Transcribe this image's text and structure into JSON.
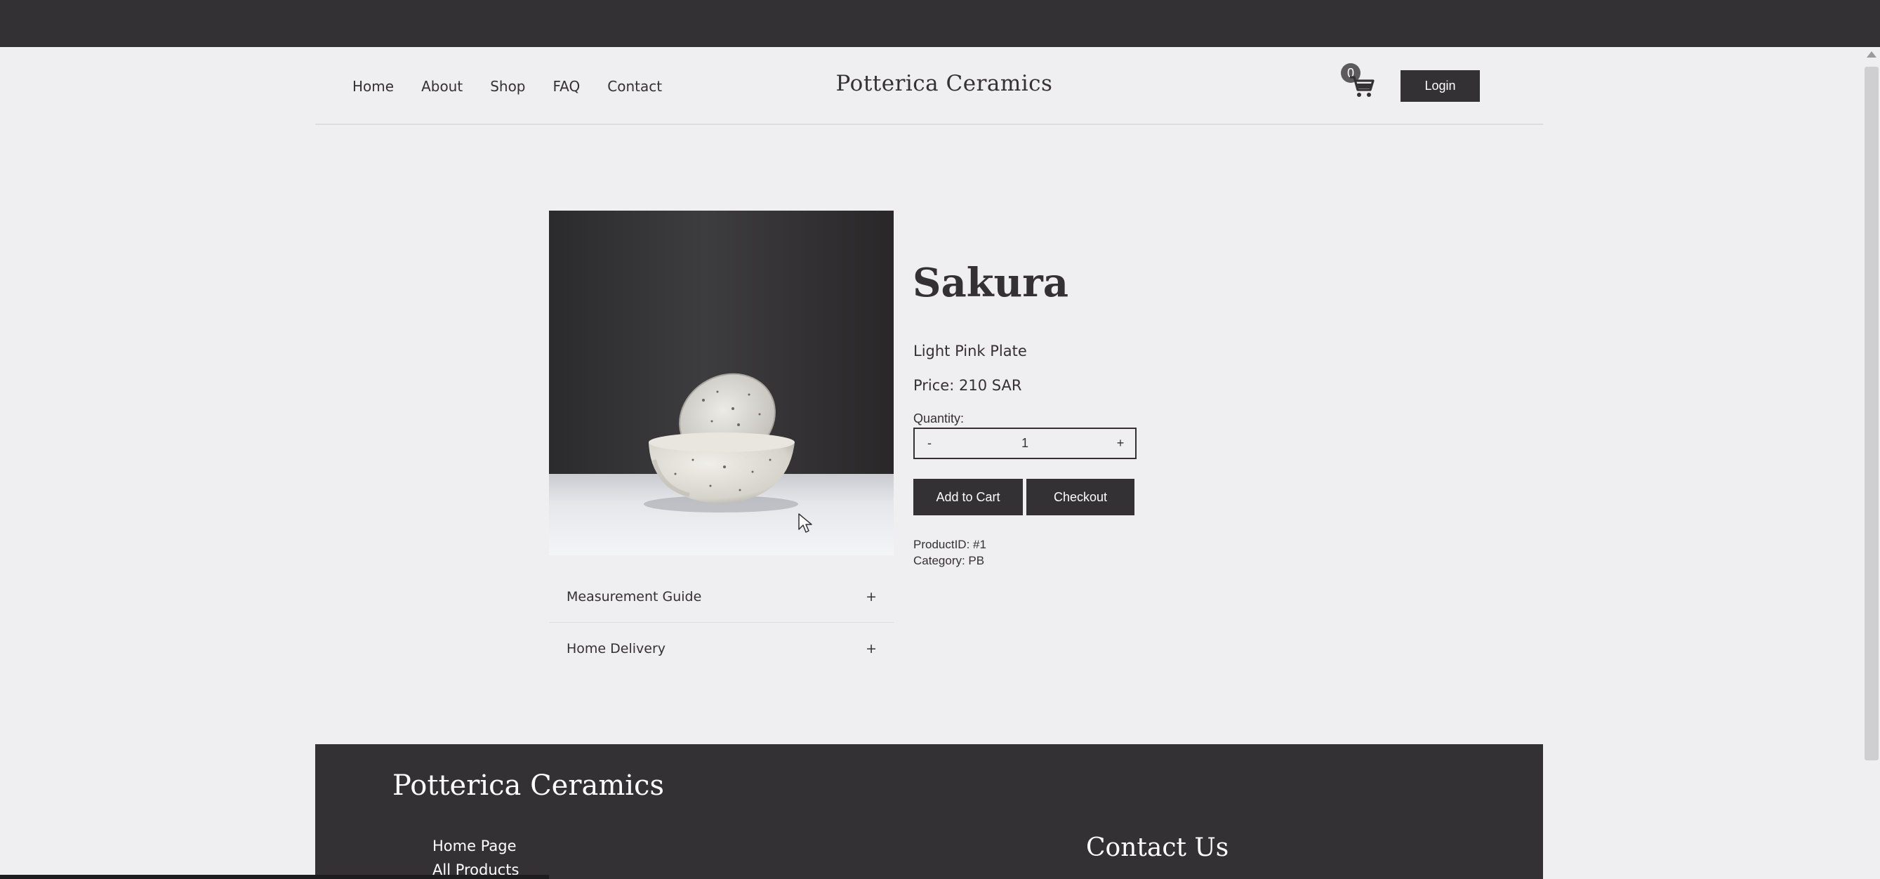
{
  "header": {
    "nav": [
      "Home",
      "About",
      "Shop",
      "FAQ",
      "Contact"
    ],
    "brand": "Potterica Ceramics",
    "cart_count": "0",
    "login_label": "Login"
  },
  "product": {
    "title": "Sakura",
    "subtitle": "Light Pink Plate",
    "price": "Price: 210 SAR",
    "quantity_label": "Quantity:",
    "quantity_minus": "-",
    "quantity_value": "1",
    "quantity_plus": "+",
    "add_to_cart_label": "Add to Cart",
    "checkout_label": "Checkout",
    "product_id": "ProductID: #1",
    "category": "Category: PB"
  },
  "accordion": [
    {
      "label": "Measurement Guide",
      "icon": "+"
    },
    {
      "label": "Home Delivery",
      "icon": "+"
    }
  ],
  "footer": {
    "brand": "Potterica Ceramics",
    "links": [
      "Home Page",
      "All Products"
    ],
    "contact_heading": "Contact Us"
  },
  "colors": {
    "dark": "#333134",
    "background": "#efeef0"
  }
}
